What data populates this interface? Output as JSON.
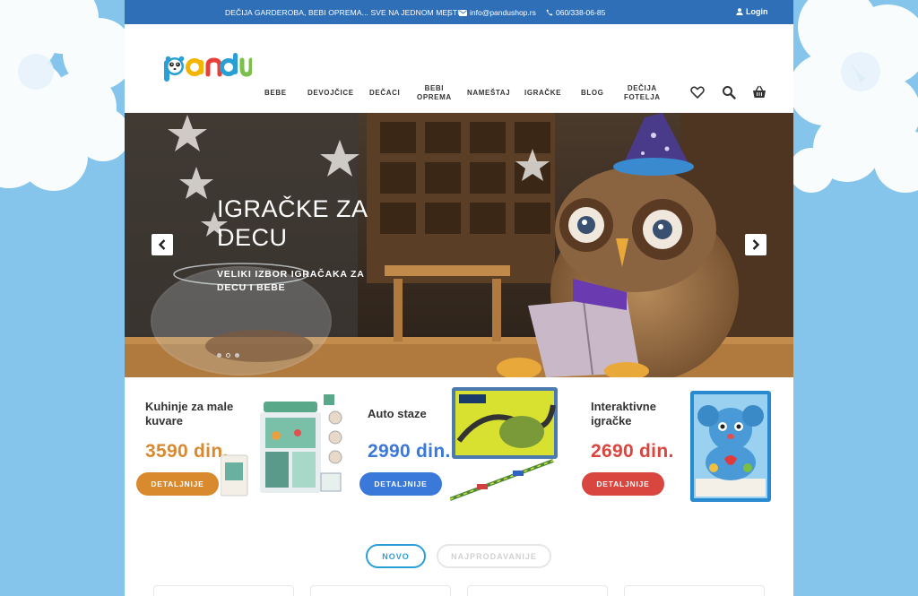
{
  "topbar": {
    "promo": "DEČIJA GARDEROBA, BEBI OPREMA... SVE NA JEDNOM MESTU!",
    "separator": "|",
    "email": "info@pandushop.rs",
    "phone": "060/338-06-85",
    "login": "Login"
  },
  "logo": {
    "text": "pandu"
  },
  "nav": {
    "items": [
      {
        "label": "BEBE"
      },
      {
        "label": "DEVOJČICE"
      },
      {
        "label": "DEČACI"
      },
      {
        "label": "BEBI\nOPREMA"
      },
      {
        "label": "NAMEŠTAJ"
      },
      {
        "label": "IGRAČKE"
      },
      {
        "label": "BLOG"
      },
      {
        "label": "DEČIJA\nFOTELJA"
      }
    ]
  },
  "icons": {
    "wishlist": "heart-icon",
    "search": "search-icon",
    "cart": "basket-icon"
  },
  "hero": {
    "title_line1": "IGRAČKE ZA",
    "title_line2": "DECU",
    "subtitle_line1": "VELIKI IZBOR IGRAČAKA ZA",
    "subtitle_line2": "DECU I BEBE",
    "slides_count": 3,
    "active_slide": 2
  },
  "cards": [
    {
      "title": "Kuhinje za male kuvare",
      "price": "3590 din.",
      "button": "DETALJNIJE",
      "color": "#d98a2e"
    },
    {
      "title": "Auto staze",
      "price": "2990 din.",
      "button": "DETALJNIJE",
      "color": "#3a78d9"
    },
    {
      "title": "Interaktivne igračke",
      "price": "2690 din.",
      "button": "DETALJNIJE",
      "color": "#d9453f"
    }
  ],
  "tabs": {
    "new": "NOVO",
    "bestsellers": "NAJPRODAVANIJE"
  },
  "colors": {
    "topbar": "#2f6fb8",
    "accent_blue": "#2a9fd6",
    "background": "#8cc7ea"
  }
}
